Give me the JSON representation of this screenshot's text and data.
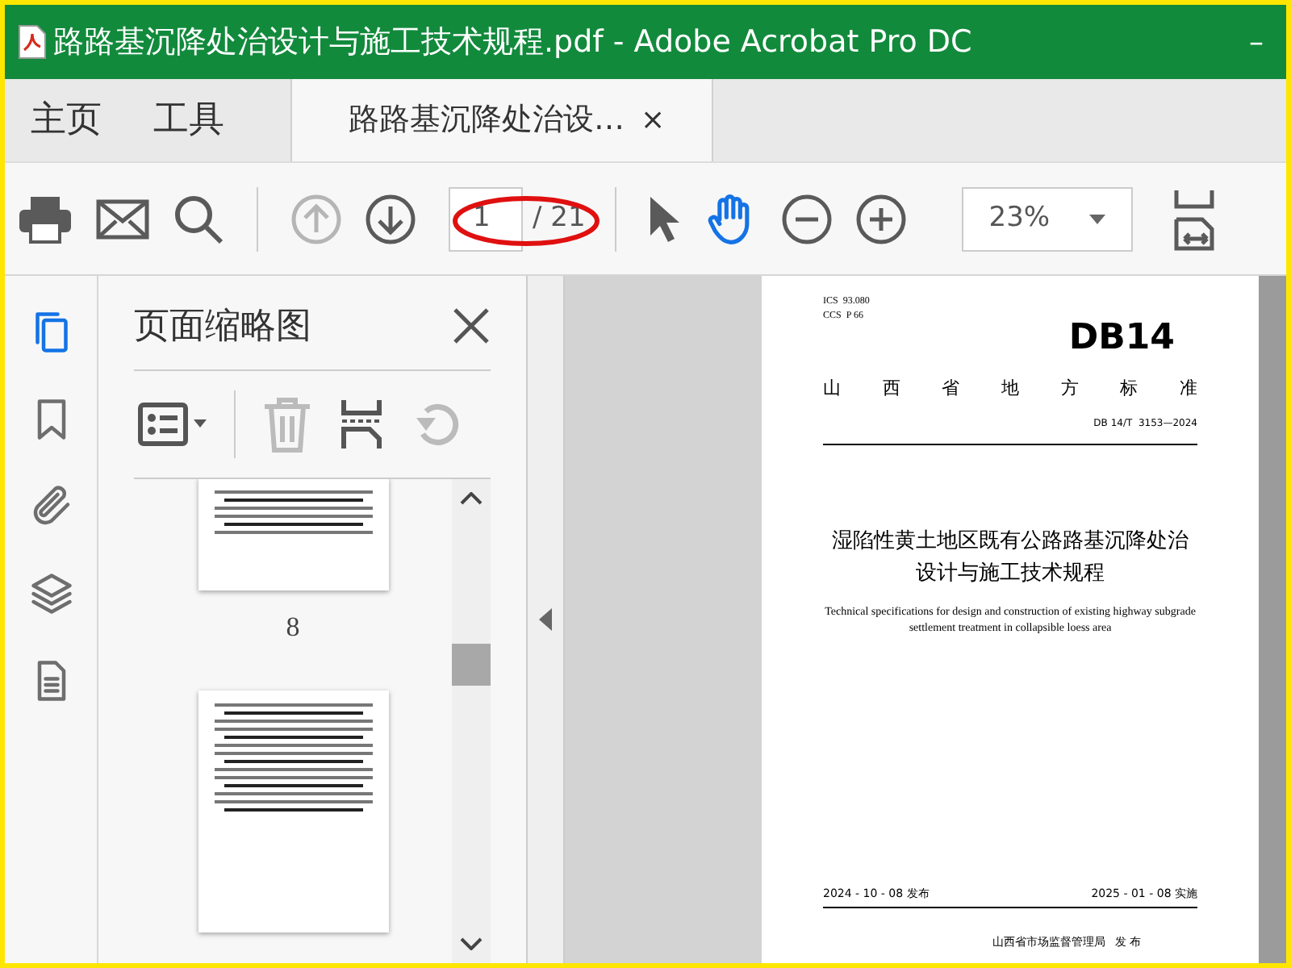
{
  "window": {
    "title": "路路基沉降处治设计与施工技术规程.pdf - Adobe Acrobat Pro DC",
    "minimize": "–"
  },
  "tabs": [
    {
      "label": "主页",
      "kind": "nav",
      "selected": false
    },
    {
      "label": "工具",
      "kind": "nav",
      "selected": false
    },
    {
      "label": "路路基沉降处治设…",
      "kind": "doc",
      "selected": true,
      "close": "×"
    }
  ],
  "toolbar": {
    "page_input": "1",
    "page_total": "/ 21",
    "zoom": "23%"
  },
  "sidebar": {
    "items": [
      {
        "kind": "pages",
        "selected": true
      },
      {
        "kind": "bookmark",
        "selected": false
      },
      {
        "kind": "attach",
        "selected": false
      },
      {
        "kind": "layers",
        "selected": false
      },
      {
        "kind": "doc",
        "selected": false
      }
    ]
  },
  "thumbnails_panel": {
    "title": "页面缩略图",
    "pages": [
      {
        "label": "8",
        "kind": "table"
      },
      {
        "kind": "text"
      }
    ]
  },
  "document": {
    "ics": "ICS  93.080",
    "ccs": "CCS  P 66",
    "code": "DB14",
    "category": [
      "山",
      "西",
      "省",
      "地",
      "方",
      "标",
      "准"
    ],
    "number": "DB 14/T  3153—2024",
    "title_cn": "湿陷性黄土地区既有公路路基沉降处治设计与施工技术规程",
    "title_en": "Technical specifications for design and construction of existing highway subgrade settlement treatment in collapsible loess area",
    "issued": "2024 - 10 - 08 发布",
    "effective": "2025 - 01 - 08 实施",
    "issuer": "山西省市场监督管理局",
    "issuer_action": "发 布"
  }
}
